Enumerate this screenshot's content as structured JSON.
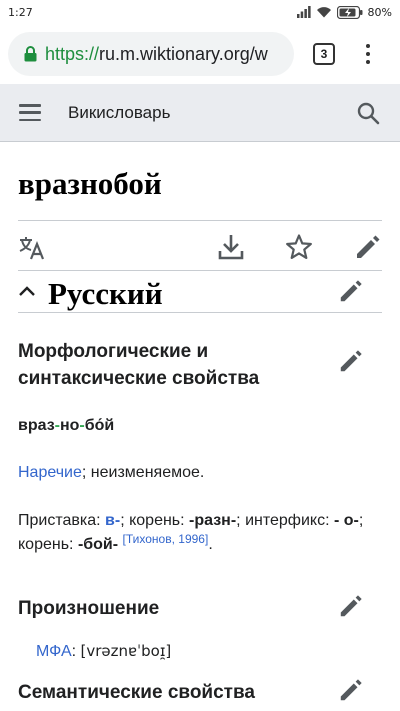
{
  "status_bar": {
    "time": "1:27",
    "battery": "80%"
  },
  "browser": {
    "url_scheme": "https://",
    "url_host": "ru.m.wiktionary.org/w",
    "tab_count": "3"
  },
  "header": {
    "site_name": "Викисловарь"
  },
  "article": {
    "title": "вразнобой",
    "language_section": "Русский",
    "morph_heading": "Морфологические и синтаксические свойства",
    "syllables": {
      "s1": "враз",
      "s2": "но",
      "s3": "бо́й",
      "separator": "-"
    },
    "pos": {
      "link": "Наречие",
      "rest": "; неизменяемое."
    },
    "morphemes": {
      "prefix_label": "Приставка: ",
      "prefix": "в-",
      "root_label": "; корень: ",
      "root": "-разн-",
      "interfix_label": "; интерфикс: ",
      "interfix_a": "-",
      "interfix_b": "о-",
      "root2_label": "; корень: ",
      "root2": "-бой-",
      "ref": "[Тихонов, 1996]",
      "end": "."
    },
    "pronunciation_heading": "Произношение",
    "ipa_label": "МФА",
    "ipa_value": "[vrəznɐˈboɪ̯]",
    "semantic_heading": "Семантические свойства"
  },
  "colors": {
    "link": "#3366cc",
    "header_bg": "#eaecf0",
    "url_scheme": "#1e8e3e"
  }
}
